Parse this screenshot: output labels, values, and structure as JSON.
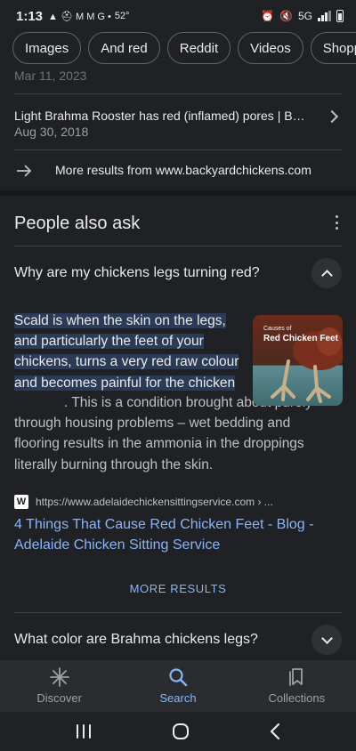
{
  "status_bar": {
    "time": "1:13",
    "temperature": "52°",
    "network": "5G",
    "notification_glyphs": "▲ ⛑ M M G •"
  },
  "chips": [
    "Images",
    "And red",
    "Reddit",
    "Videos",
    "Shopping"
  ],
  "prev_result": {
    "date_partial": "Mar 11, 2023"
  },
  "result": {
    "title": "Light Brahma Rooster has red (inflamed) pores | Bac...",
    "date": "Aug 30, 2018"
  },
  "more_from": {
    "text": "More results from www.backyardchickens.com"
  },
  "people_also_ask": {
    "title": "People also ask",
    "questions": [
      {
        "text": "Why are my chickens legs turning red?",
        "expanded": true
      },
      {
        "text": "What color are Brahma chickens legs?",
        "expanded": false
      }
    ],
    "answer": {
      "highlighted": "Scald is when the skin on the legs, and particularly the feet of your chickens, turns a very red raw colour and becomes painful for the chicken",
      "rest": ". This is a condition brought about purely through housing problems – wet bedding and flooring results in the ammonia in the droppings literally burning through the skin.",
      "image_caption_small": "Causes of",
      "image_caption": "Red Chicken Feet"
    },
    "source": {
      "favicon_letter": "W",
      "url": "https://www.adelaidechickensittingservice.com › ...",
      "link_text": "4 Things That Cause Red Chicken Feet - Blog - Adelaide Chicken Sitting Service"
    },
    "more_results_label": "MORE RESULTS"
  },
  "bottom_nav": {
    "items": [
      {
        "label": "Discover",
        "icon": "asterisk-icon",
        "active": false
      },
      {
        "label": "Search",
        "icon": "search-icon",
        "active": true
      },
      {
        "label": "Collections",
        "icon": "bookmarks-icon",
        "active": false
      }
    ]
  },
  "colors": {
    "background": "#202124",
    "link": "#8ab4f8",
    "highlight": "#2b3a55"
  }
}
